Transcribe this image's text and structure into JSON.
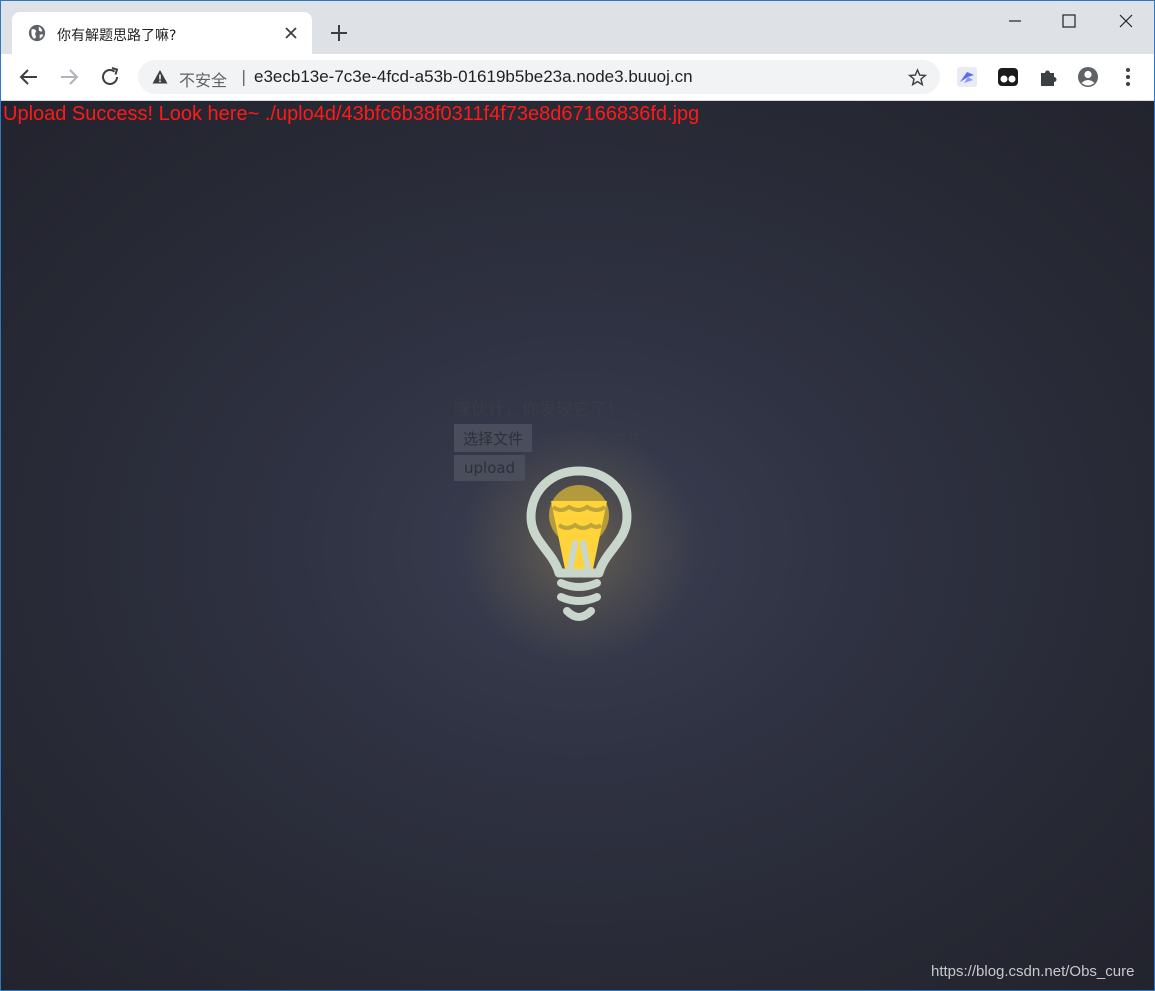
{
  "browser": {
    "tab_title": "你有解题思路了嘛?",
    "security_label": "不安全",
    "url_separator": "|",
    "url": "e3ecb13e-7c3e-4fcd-a53b-01619b5be23a.node3.buuoj.cn"
  },
  "page": {
    "success_message": "Upload Success! Look here~ ./uplo4d/43bfc6b38f0311f4f73e8d67166836fd.jpg",
    "prompt": "嘿伙计，你发现它了！",
    "choose_file_label": "选择文件",
    "no_file_label": "未选择任何文件",
    "upload_label": "upload"
  },
  "watermark": "https://blog.csdn.net/Obs_cure",
  "colors": {
    "success_text": "#ff1a1a",
    "bulb_body": "#c9d6cc",
    "bulb_filament": "#ffd43b"
  }
}
